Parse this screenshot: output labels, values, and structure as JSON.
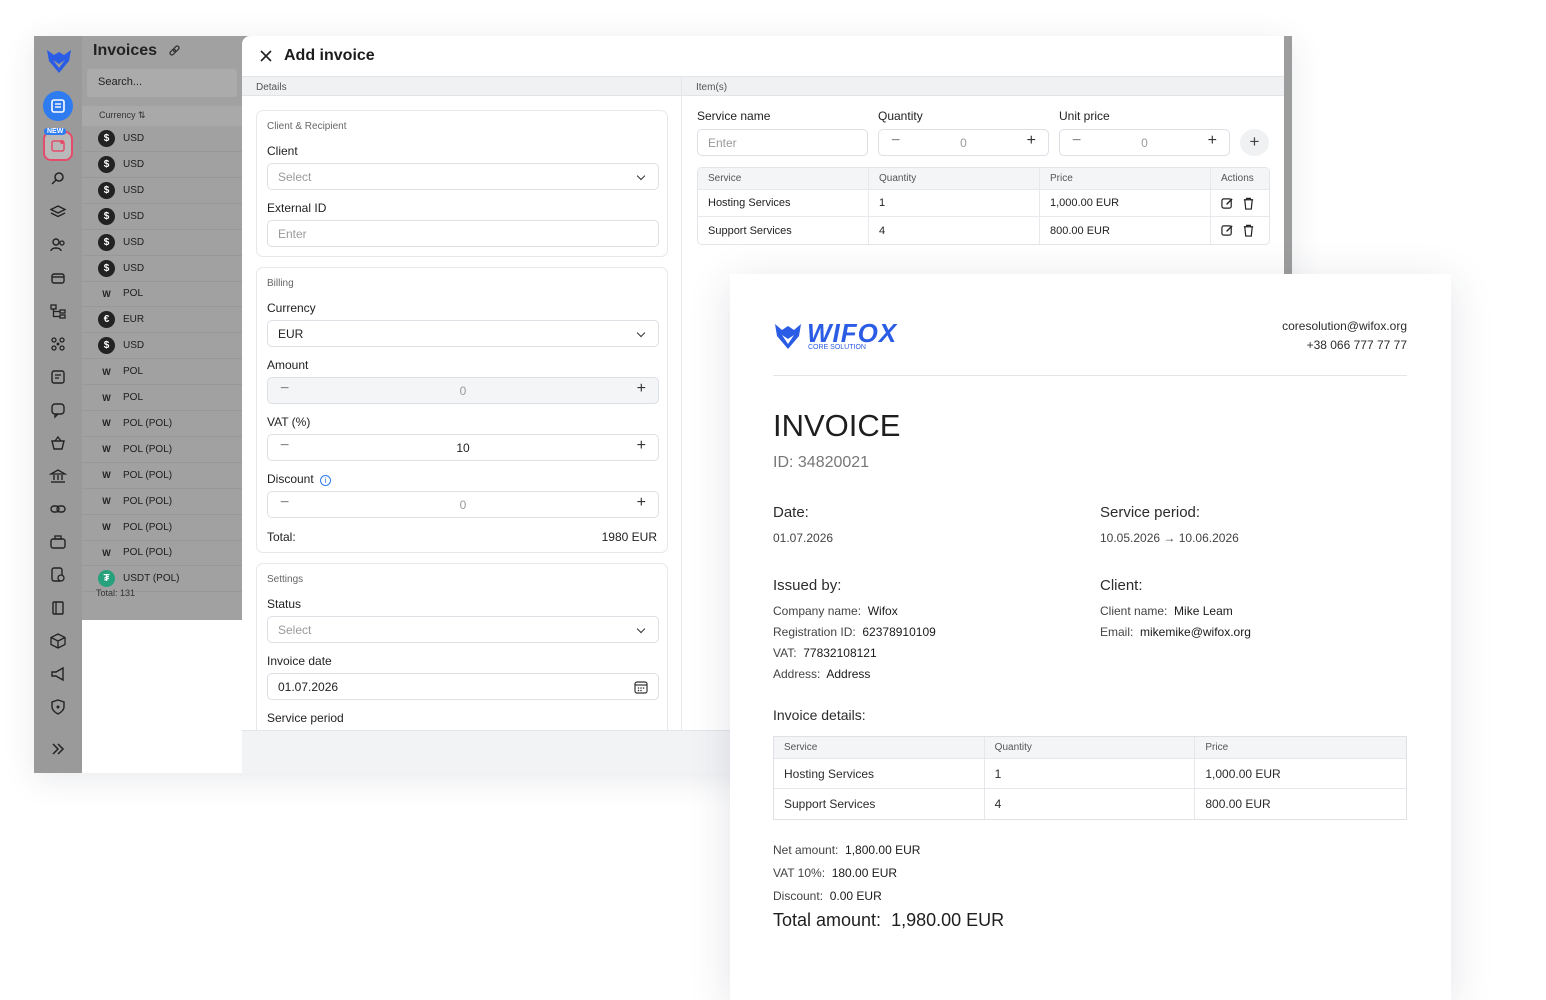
{
  "app": {
    "title": "Invoices",
    "search_placeholder": "Search...",
    "currency_header": "Currency",
    "currency_sort_icon": "sort-icon",
    "currencies": [
      {
        "icon": "$",
        "label": "USD"
      },
      {
        "icon": "$",
        "label": "USD"
      },
      {
        "icon": "$",
        "label": "USD"
      },
      {
        "icon": "$",
        "label": "USD"
      },
      {
        "icon": "$",
        "label": "USD"
      },
      {
        "icon": "$",
        "label": "USD"
      },
      {
        "icon": "W",
        "label": "POL"
      },
      {
        "icon": "€",
        "label": "EUR"
      },
      {
        "icon": "$",
        "label": "USD"
      },
      {
        "icon": "W",
        "label": "POL"
      },
      {
        "icon": "W",
        "label": "POL"
      },
      {
        "icon": "W",
        "label": "POL (POL)"
      },
      {
        "icon": "W",
        "label": "POL (POL)"
      },
      {
        "icon": "W",
        "label": "POL (POL)"
      },
      {
        "icon": "W",
        "label": "POL (POL)"
      },
      {
        "icon": "W",
        "label": "POL (POL)"
      },
      {
        "icon": "W",
        "label": "POL (POL)"
      },
      {
        "icon": "₮",
        "label": "USDT (POL)"
      }
    ],
    "total": "Total: 131",
    "rail_new_tag": "NEW"
  },
  "drawer": {
    "title": "Add invoice",
    "details_label": "Details",
    "items_label": "Item(s)",
    "client_section": "Client & Recipient",
    "client_label": "Client",
    "client_placeholder": "Select",
    "external_id_label": "External ID",
    "external_id_placeholder": "Enter",
    "billing_section": "Billing",
    "currency_label": "Currency",
    "currency_value": "EUR",
    "amount_label": "Amount",
    "amount_value": "0",
    "vat_label": "VAT (%)",
    "vat_value": "10",
    "discount_label": "Discount",
    "discount_value": "0",
    "total_label": "Total:",
    "total_value": "1980 EUR",
    "settings_section": "Settings",
    "status_label": "Status",
    "status_placeholder": "Select",
    "invoice_date_label": "Invoice date",
    "invoice_date_value": "01.07.2026",
    "service_period_label": "Service period",
    "service_name_label": "Service name",
    "service_name_placeholder": "Enter",
    "quantity_label": "Quantity",
    "quantity_value": "0",
    "unit_price_label": "Unit price",
    "unit_price_value": "0",
    "items_table": {
      "headers": [
        "Service",
        "Quantity",
        "Price",
        "Actions"
      ],
      "rows": [
        [
          "Hosting Services",
          "1",
          "1,000.00 EUR"
        ],
        [
          "Support Services",
          "4",
          "800.00 EUR"
        ]
      ]
    }
  },
  "invoice": {
    "brand": "WIFOX",
    "brand_sub": "CORE SOLUTION",
    "email": "coresolution@wifox.org",
    "phone": "+38 066 777 77 77",
    "heading": "INVOICE",
    "id": "ID: 34820021",
    "date_label": "Date:",
    "date_value": "01.07.2026",
    "period_label": "Service period:",
    "period_value": "10.05.2026 → 10.06.2026",
    "issued_label": "Issued by:",
    "company_label": "Company name:",
    "company_value": "Wifox",
    "reg_label": "Registration ID:",
    "reg_value": "62378910109",
    "vat_label": "VAT:",
    "vat_value": "77832108121",
    "address_label": "Address:",
    "address_value": "Address",
    "client_label": "Client:",
    "client_name_label": "Client name:",
    "client_name_value": "Mike Leam",
    "client_email_label": "Email:",
    "client_email_value": "mikemike@wifox.org",
    "details_label": "Invoice details:",
    "table": {
      "headers": [
        "Service",
        "Quantity",
        "Price"
      ],
      "rows": [
        [
          "Hosting Services",
          "1",
          "1,000.00 EUR"
        ],
        [
          "Support Services",
          "4",
          "800.00 EUR"
        ]
      ]
    },
    "net_label": "Net amount:",
    "net_value": "1,800.00 EUR",
    "vat_sum_label": "VAT 10%:",
    "vat_sum_value": "180.00 EUR",
    "discount_label": "Discount:",
    "discount_value": "0.00 EUR",
    "total_label": "Total amount:",
    "total_value": "1,980.00 EUR"
  },
  "colors": {
    "accent": "#2f7bf0",
    "brand": "#2b5ce6"
  }
}
